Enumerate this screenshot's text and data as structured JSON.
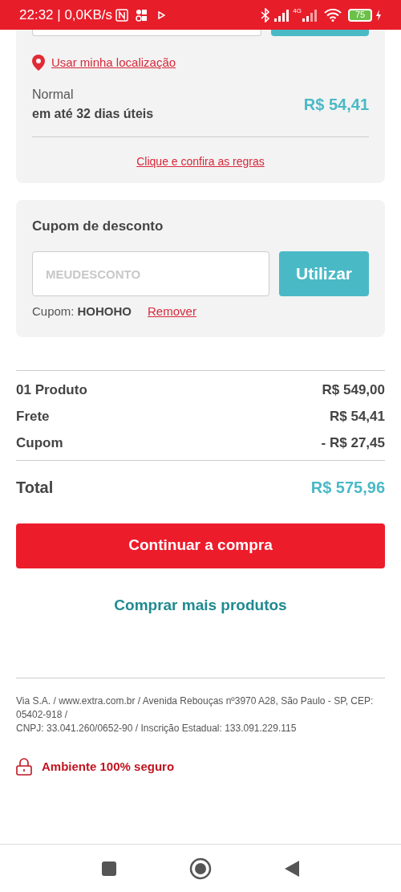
{
  "status_bar": {
    "time": "22:32 | 0,0KB/s",
    "network": "4G",
    "battery": "75"
  },
  "shipping": {
    "location_link": "Usar minha localização",
    "option_name": "Normal",
    "option_time": "em até 32 dias úteis",
    "option_price": "R$ 54,41",
    "rules_link": "Clique e confira as regras"
  },
  "coupon": {
    "title": "Cupom de desconto",
    "placeholder": "MEUDESCONTO",
    "button": "Utilizar",
    "applied_label": "Cupom:",
    "applied_code": "HOHOHO",
    "remove_link": "Remover"
  },
  "summary": {
    "rows": [
      {
        "label": "01 Produto",
        "value": "R$ 549,00"
      },
      {
        "label": "Frete",
        "value": "R$ 54,41"
      },
      {
        "label": "Cupom",
        "value": "- R$ 27,45"
      }
    ],
    "total_label": "Total",
    "total_value": "R$ 575,96"
  },
  "continue_button": "Continuar a compra",
  "more_link": "Comprar mais produtos",
  "footer": {
    "address_lines": [
      "Via S.A. / www.extra.com.br / Avenida Rebouças nº3970 A28, São Paulo - SP, CEP: 05402-918 /",
      "CNPJ: 33.041.260/0652-90 / Inscrição Estadual: 133.091.229.115"
    ],
    "secure": "Ambiente 100% seguro"
  }
}
